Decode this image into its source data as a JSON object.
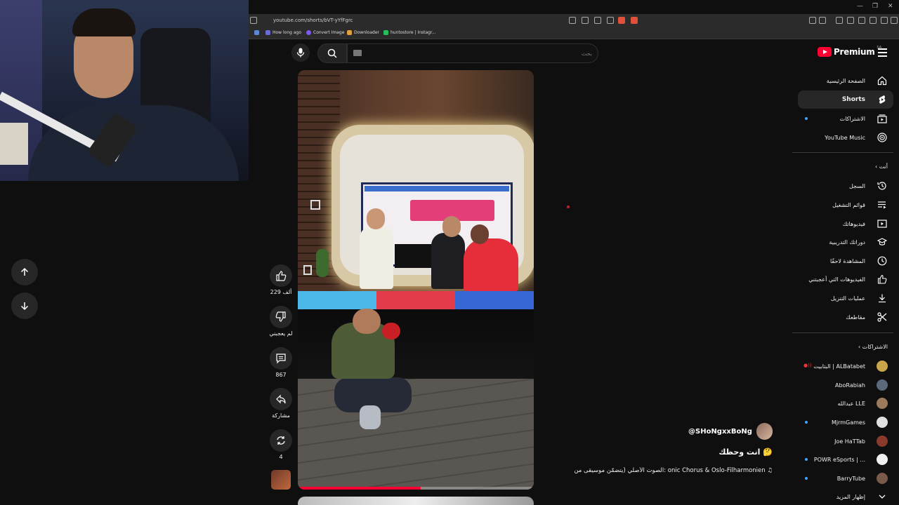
{
  "browser": {
    "url": "youtube.com/shorts/bVT-yYfFgrc",
    "bookmarks": [
      {
        "label": "How long ago",
        "color": "#6b6bd6"
      },
      {
        "label": "Convert Image",
        "color": "#7a5af0"
      },
      {
        "label": "Downloader",
        "color": "#e0a040"
      },
      {
        "label": "huntostore | Instagr...",
        "color": "#25c05a"
      }
    ]
  },
  "header": {
    "logo_text": "Premium",
    "logo_region": "SA",
    "search_placeholder": "بحث"
  },
  "short": {
    "progress_fraction": 0.52,
    "likes": "229 ألف",
    "dislike_label": "لم يعجبني",
    "comments": "867",
    "share_label": "مشاركة",
    "remix_count": "4",
    "channel": "@SHoNgxxBoNg",
    "title": "انت وحظك 🤔",
    "sound": "الصوت الأصلي (يتضمّن موسيقى من: onic Chorus & Oslo-Filharmonien"
  },
  "sidebar": {
    "main": [
      {
        "label": "الصفحة الرئيسية",
        "icon": "home-icon",
        "active": false,
        "dot": false
      },
      {
        "label": "Shorts",
        "icon": "shorts-icon",
        "active": true,
        "dot": false
      },
      {
        "label": "الاشتراكات",
        "icon": "subscriptions-icon",
        "active": false,
        "dot": true
      },
      {
        "label": "YouTube Music",
        "icon": "youtube-music-icon",
        "active": false,
        "dot": false
      }
    ],
    "you_header": "أنت",
    "you": [
      {
        "label": "السجل",
        "icon": "history-icon"
      },
      {
        "label": "قوائم التشغيل",
        "icon": "playlists-icon"
      },
      {
        "label": "فيديوهاتك",
        "icon": "your-videos-icon"
      },
      {
        "label": "دوراتك التدريبية",
        "icon": "courses-icon"
      },
      {
        "label": "المشاهدة لاحقًا",
        "icon": "watch-later-icon"
      },
      {
        "label": "الفيديوهات التي أعجبتني",
        "icon": "liked-videos-icon"
      },
      {
        "label": "عمليات التنزيل",
        "icon": "downloads-icon"
      },
      {
        "label": "مقاطعك",
        "icon": "clips-icon"
      }
    ],
    "subs_header": "الاشتراكات",
    "subscriptions": [
      {
        "label": "البتابيت | ALBatabet",
        "color": "#c9a64a",
        "live": true,
        "dot": false
      },
      {
        "label": "AboRabiah",
        "color": "#5a6a7a",
        "live": false,
        "dot": false
      },
      {
        "label": "عبدالله LLE",
        "color": "#9a7a5a",
        "live": false,
        "dot": false
      },
      {
        "label": "MjrmGames",
        "color": "#e0e0e0",
        "live": false,
        "dot": true
      },
      {
        "label": "Joe HaTTab",
        "color": "#8a3a2a",
        "live": false,
        "dot": false
      },
      {
        "label": "POWR eSports | ...",
        "color": "#f0f0f0",
        "live": false,
        "dot": true
      },
      {
        "label": "BarryTube",
        "color": "#7a5a4a",
        "live": false,
        "dot": true
      }
    ],
    "show_more": "إظهار المزيد"
  }
}
